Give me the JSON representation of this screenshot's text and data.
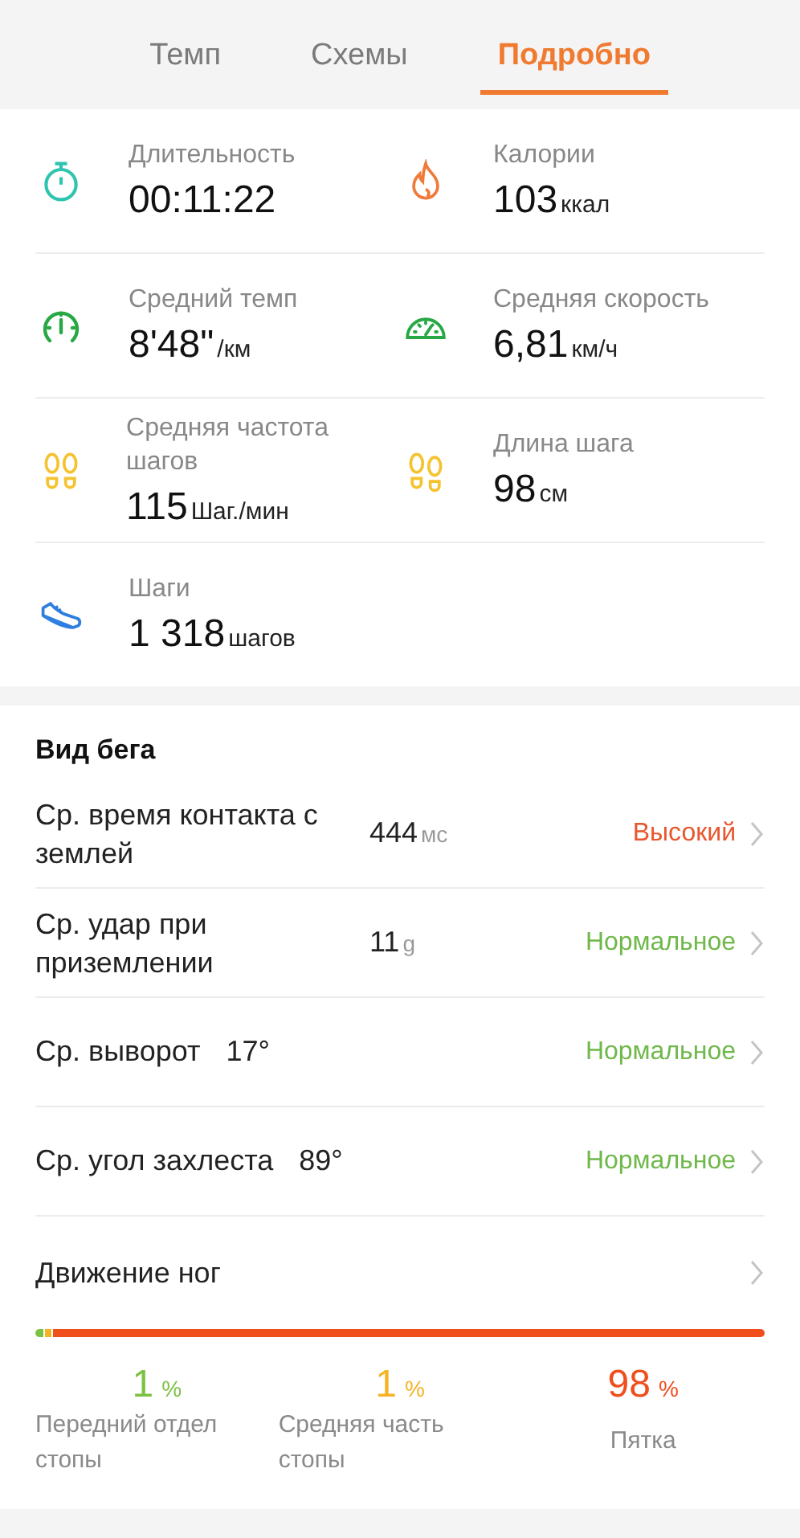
{
  "tabs": [
    {
      "label": "Темп",
      "selected": false
    },
    {
      "label": "Схемы",
      "selected": false
    },
    {
      "label": "Подробно",
      "selected": true
    }
  ],
  "stats": [
    {
      "kind": "stopwatch",
      "label": "Длительность",
      "value": "00:11:22"
    },
    {
      "kind": "flame",
      "label": "Калории",
      "value": "103",
      "unit": "ккал"
    },
    {
      "kind": "pace",
      "label": "Средний темп",
      "value": "8'48\"",
      "unit": "/км"
    },
    {
      "kind": "speed",
      "label": "Средняя скорость",
      "value": "6,81",
      "unit": "км/ч"
    },
    {
      "kind": "cadence",
      "label": "Средняя частота шагов",
      "value": "115",
      "unit": "Шаг./мин"
    },
    {
      "kind": "stride",
      "label": "Длина шага",
      "value": "98",
      "unit": "см"
    },
    {
      "kind": "shoe",
      "label": "Шаги",
      "value": "1 318",
      "unit": "шагов"
    }
  ],
  "gait": {
    "title": "Вид бега",
    "rows": [
      {
        "kind": "column",
        "label": "Ср. время контакта с землей",
        "value": "444",
        "unit": "мс",
        "rating": "Высокий",
        "color": "#e8562e"
      },
      {
        "kind": "column",
        "label": "Ср. удар при приземлении",
        "value": "11",
        "unit": "g",
        "rating": "Нормальное",
        "color": "#6fb84a"
      },
      {
        "kind": "inline",
        "label": "Ср. выворот",
        "value": "17°",
        "rating": "Нормальное",
        "color": "#6fb84a"
      },
      {
        "kind": "inline",
        "label": "Ср. угол захлеста",
        "value": "89°",
        "rating": "Нормальное",
        "color": "#6fb84a"
      }
    ]
  },
  "foot_strike": {
    "title": "Движение ног",
    "parts": [
      {
        "label": "Передний отдел стопы",
        "value": "1",
        "unit": "%",
        "color": "#7cc242"
      },
      {
        "label": "Средняя часть стопы",
        "value": "1",
        "unit": "%",
        "color": "#f5b324"
      },
      {
        "label": "Пятка",
        "value": "98",
        "unit": "%",
        "color": "#f04e1c"
      }
    ]
  }
}
